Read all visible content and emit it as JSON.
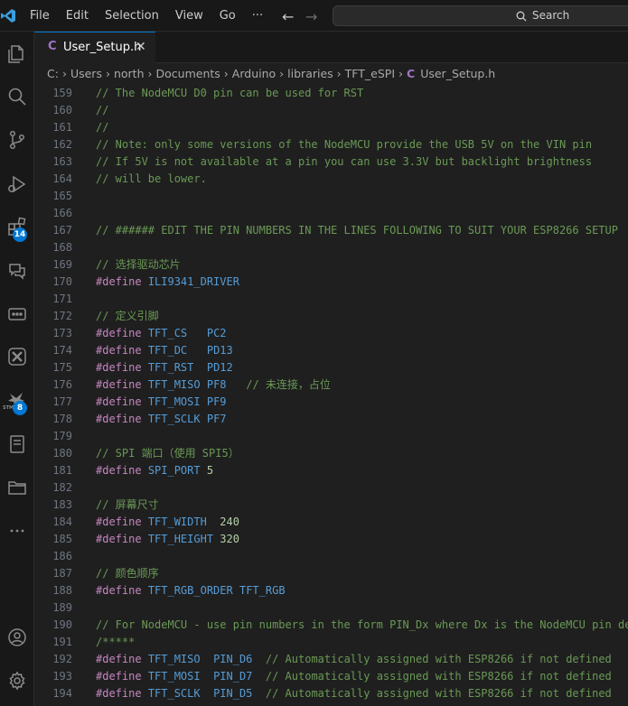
{
  "titlebar": {
    "menu": [
      "File",
      "Edit",
      "Selection",
      "View",
      "Go",
      "···"
    ],
    "search_label": "Search"
  },
  "activity_bar": {
    "items": [
      "explorer-icon",
      "search-icon",
      "source-control-icon",
      "run-debug-icon",
      "extensions-icon",
      "chat-icon",
      "remote-icon",
      "x-icon",
      "stm32-icon",
      "document-icon",
      "folder-icon",
      "more-icon"
    ],
    "extensions_badge": "14",
    "stm32_badge": "8",
    "stm32_label": "STM",
    "bottom": [
      "account-icon",
      "settings-icon"
    ]
  },
  "tab": {
    "icon": "C",
    "name": "User_Setup.h",
    "close": "✕"
  },
  "breadcrumb": [
    "C:",
    "Users",
    "north",
    "Documents",
    "Arduino",
    "libraries",
    "TFT_eSPI",
    "User_Setup.h"
  ],
  "colors": {
    "accent": "#0078d4",
    "comment": "#6a9955",
    "directive": "#c586c0",
    "macro": "#569cd6",
    "number": "#b5cea8",
    "c_icon": "#a074c4"
  },
  "lines": [
    {
      "n": "159",
      "t": "// The NodeMCU D0 pin can be used for RST"
    },
    {
      "n": "160",
      "t": "//"
    },
    {
      "n": "161",
      "t": "//"
    },
    {
      "n": "162",
      "t": "// Note: only some versions of the NodeMCU provide the USB 5V on the VIN pin"
    },
    {
      "n": "163",
      "t": "// If 5V is not available at a pin you can use 3.3V but backlight brightness"
    },
    {
      "n": "164",
      "t": "// will be lower."
    },
    {
      "n": "165",
      "t": ""
    },
    {
      "n": "166",
      "t": ""
    },
    {
      "n": "167",
      "t": "// ###### EDIT THE PIN NUMBERS IN THE LINES FOLLOWING TO SUIT YOUR ESP8266 SETUP"
    },
    {
      "n": "168",
      "t": ""
    },
    {
      "n": "169",
      "t": "// 选择驱动芯片"
    },
    {
      "n": "170",
      "t": "#define ILI9341_DRIVER"
    },
    {
      "n": "171",
      "t": ""
    },
    {
      "n": "172",
      "t": "// 定义引脚"
    },
    {
      "n": "173",
      "t": "#define TFT_CS   PC2"
    },
    {
      "n": "174",
      "t": "#define TFT_DC   PD13"
    },
    {
      "n": "175",
      "t": "#define TFT_RST  PD12"
    },
    {
      "n": "176",
      "t": "#define TFT_MISO PF8   // 未连接，占位"
    },
    {
      "n": "177",
      "t": "#define TFT_MOSI PF9"
    },
    {
      "n": "178",
      "t": "#define TFT_SCLK PF7"
    },
    {
      "n": "179",
      "t": ""
    },
    {
      "n": "180",
      "t": "// SPI 端口（使用 SPI5）"
    },
    {
      "n": "181",
      "t": "#define SPI_PORT 5"
    },
    {
      "n": "182",
      "t": ""
    },
    {
      "n": "183",
      "t": "// 屏幕尺寸"
    },
    {
      "n": "184",
      "t": "#define TFT_WIDTH  240"
    },
    {
      "n": "185",
      "t": "#define TFT_HEIGHT 320"
    },
    {
      "n": "186",
      "t": ""
    },
    {
      "n": "187",
      "t": "// 颜色顺序"
    },
    {
      "n": "188",
      "t": "#define TFT_RGB_ORDER TFT_RGB"
    },
    {
      "n": "189",
      "t": ""
    },
    {
      "n": "190",
      "t": "// For NodeMCU - use pin numbers in the form PIN_Dx where Dx is the NodeMCU pin designation"
    },
    {
      "n": "191",
      "t": "/*****"
    },
    {
      "n": "192",
      "t": "#define TFT_MISO  PIN_D6  // Automatically assigned with ESP8266 if not defined"
    },
    {
      "n": "193",
      "t": "#define TFT_MOSI  PIN_D7  // Automatically assigned with ESP8266 if not defined"
    },
    {
      "n": "194",
      "t": "#define TFT_SCLK  PIN_D5  // Automatically assigned with ESP8266 if not defined"
    }
  ]
}
